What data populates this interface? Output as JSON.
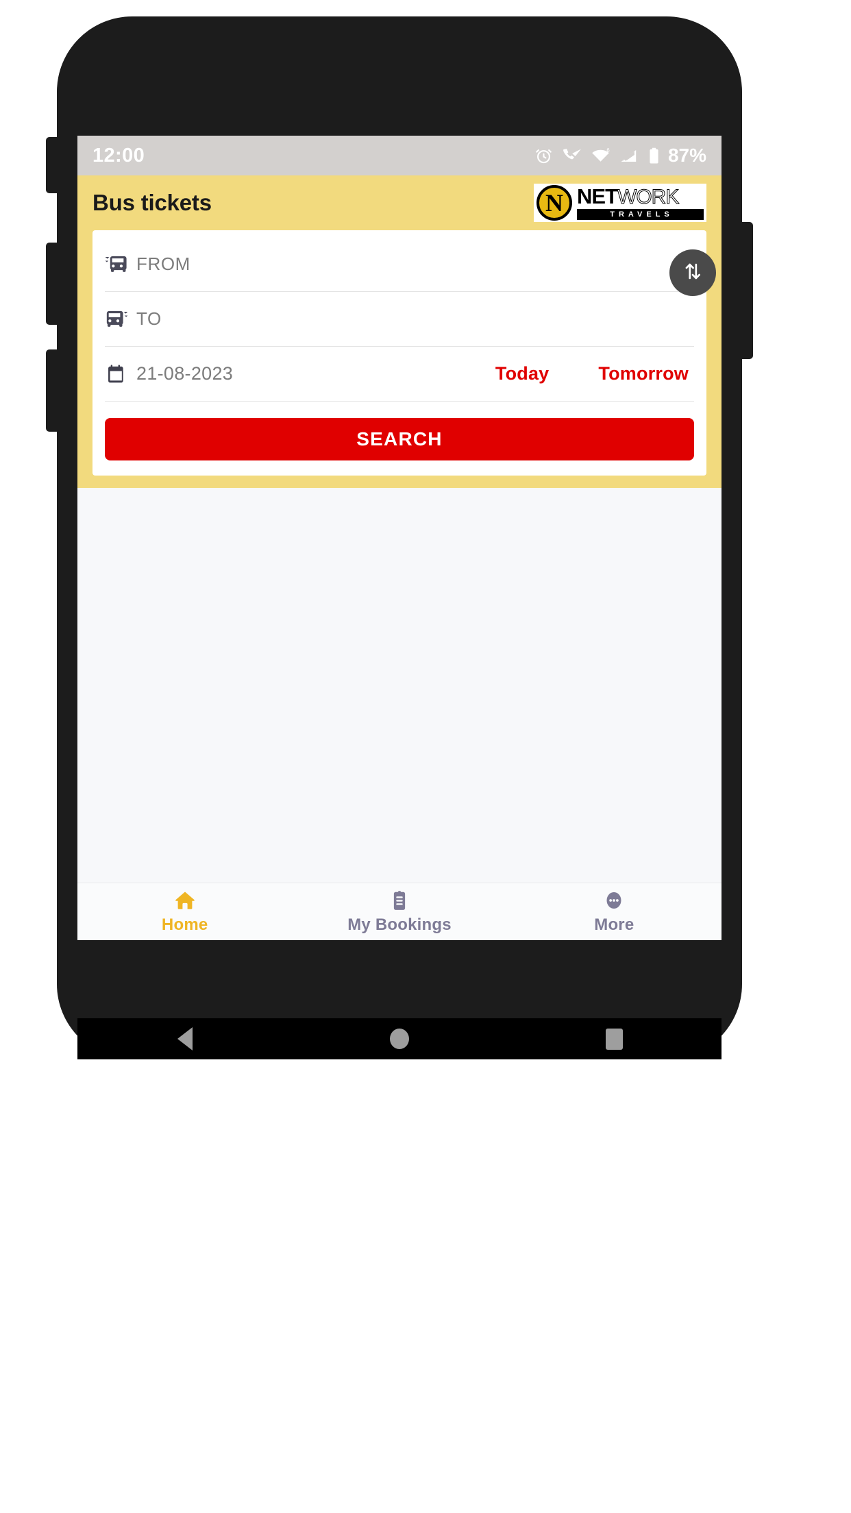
{
  "status_bar": {
    "time": "12:00",
    "battery_percent": "87%",
    "icons": [
      "alarm-clock-icon",
      "call-signal-icon",
      "wifi-icon",
      "cellular-roaming-icon",
      "battery-icon"
    ]
  },
  "app_bar": {
    "title": "Bus tickets",
    "logo": {
      "mark_letter": "N",
      "word_primary": "NET",
      "word_secondary": "WORK",
      "tagline": "TRAVELS"
    }
  },
  "search_form": {
    "from": {
      "placeholder": "FROM",
      "value": "",
      "icon": "bus-departure-icon"
    },
    "to": {
      "placeholder": "TO",
      "value": "",
      "icon": "bus-arrival-icon"
    },
    "date": {
      "value": "21-08-2023",
      "icon": "calendar-icon"
    },
    "quick_today": "Today",
    "quick_tomorrow": "Tomorrow",
    "swap_icon": "swap-vertical-icon",
    "search_label": "SEARCH"
  },
  "bottom_nav": {
    "items": [
      {
        "label": "Home",
        "icon": "home-icon",
        "active": true
      },
      {
        "label": "My Bookings",
        "icon": "clipboard-icon",
        "active": false
      },
      {
        "label": "More",
        "icon": "more-dots-icon",
        "active": false
      }
    ]
  },
  "android_nav": {
    "back": "back-triangle-icon",
    "home": "home-circle-icon",
    "recents": "recents-square-icon"
  },
  "colors": {
    "header_yellow": "#f2da7e",
    "accent_red": "#e00000",
    "active_nav": "#efb524",
    "inactive_nav": "#7e7b96",
    "logo_gold": "#e8b912",
    "status_bar_bg": "#d3d0ce"
  }
}
